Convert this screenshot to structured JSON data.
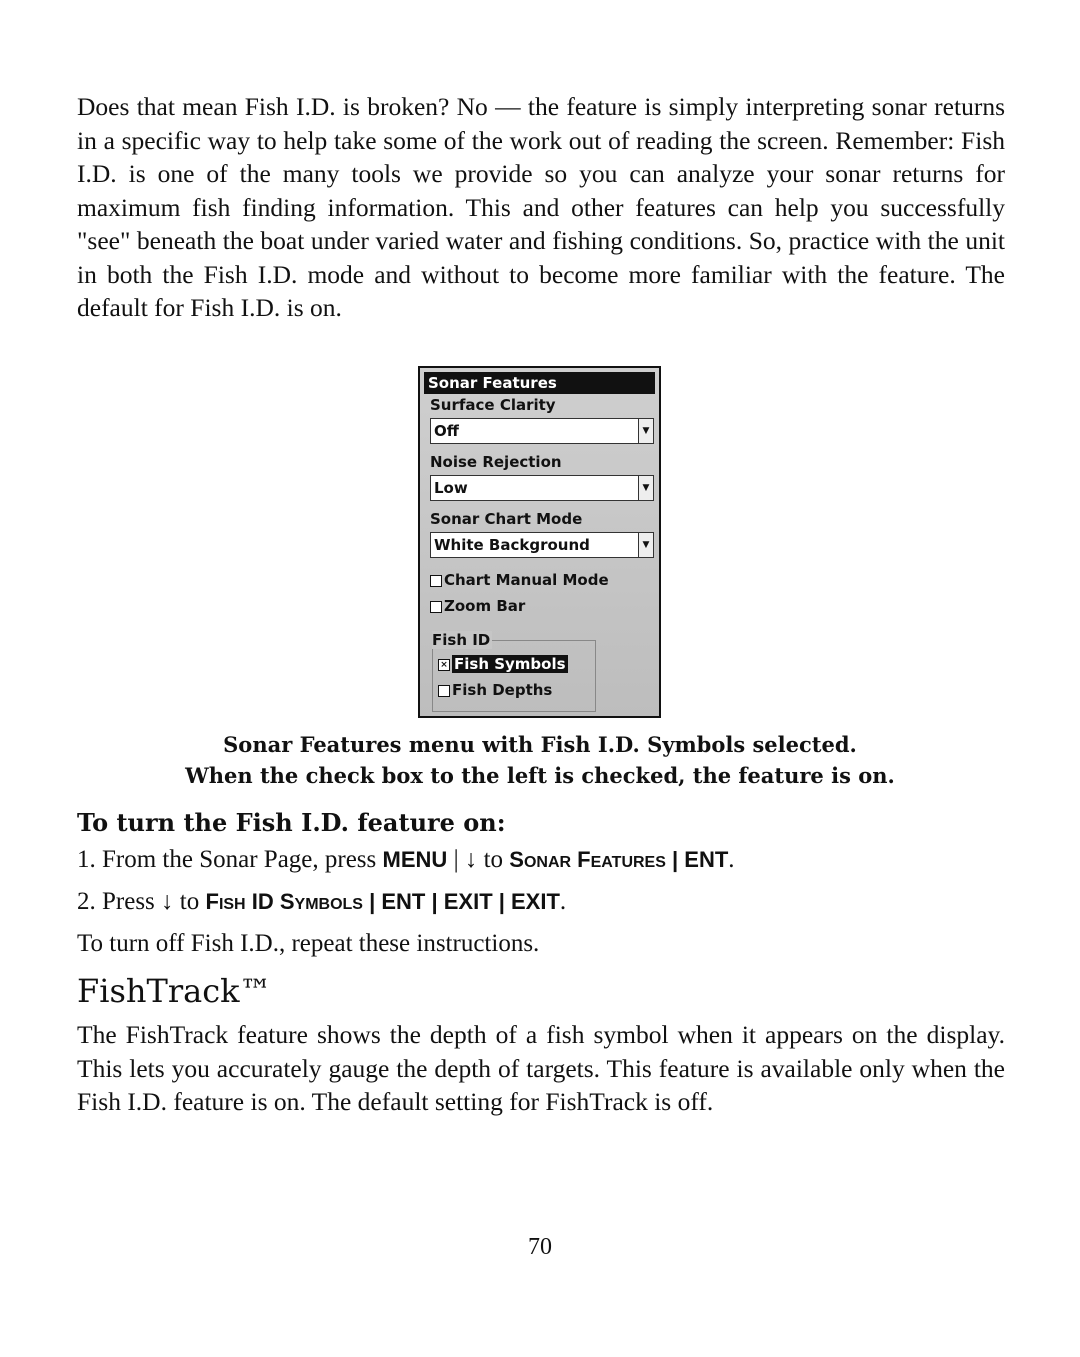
{
  "intro_paragraph": "Does that mean Fish I.D. is broken? No — the feature is simply interpreting sonar returns in a specific way to help take some of the work out of reading the screen. Remember: Fish I.D. is one of the many tools we provide so you can analyze your sonar returns for maximum fish finding information. This and other features can help you successfully \"see\" beneath the boat under varied water and fishing conditions. So, practice with the unit in both the Fish I.D. mode and without to become more familiar with the feature. The default for Fish I.D. is on.",
  "menu": {
    "title": "Sonar Features",
    "surface_label": "Surface Clarity",
    "surface_value": "Off",
    "noise_label": "Noise Rejection",
    "noise_value": "Low",
    "chart_label": "Sonar Chart Mode",
    "chart_value": "White Background",
    "chart_manual": "Chart Manual Mode",
    "zoom_bar": "Zoom Bar",
    "fish_id_group": "Fish ID",
    "fish_symbols": "Fish Symbols",
    "fish_symbols_mark": "×",
    "fish_depths": "Fish Depths"
  },
  "caption": {
    "line1": "Sonar Features menu with Fish I.D. Symbols selected.",
    "line2": "When the check box to the left is checked, the feature is on."
  },
  "howto": {
    "heading": "To turn the Fish I.D. feature on:",
    "s1_pre": "1. From the Sonar Page, press ",
    "s1_k1": "MENU",
    "s1_mid": " | ↓ to ",
    "s1_k2a": "S",
    "s1_k2b": "ONAR",
    "s1_k2c": " F",
    "s1_k2d": "EATURES",
    "s1_k3": " | ENT",
    "s1_end": ".",
    "s2_pre": "2. Press ↓ to ",
    "s2_k1a": "F",
    "s2_k1b": "ISH",
    "s2_k1c": " ID S",
    "s2_k1d": "YMBOLS",
    "s2_k2": " | ENT | EXIT | EXIT",
    "s2_end": ".",
    "off_note": "To turn off Fish I.D., repeat these instructions."
  },
  "fishtrack": {
    "heading": "FishTrack™",
    "paragraph": "The FishTrack feature shows the depth of a fish symbol when it appears on the display. This lets you accurately gauge the depth of targets. This feature is available only when the Fish I.D. feature is on. The default setting for FishTrack is off."
  },
  "page_number": "70"
}
